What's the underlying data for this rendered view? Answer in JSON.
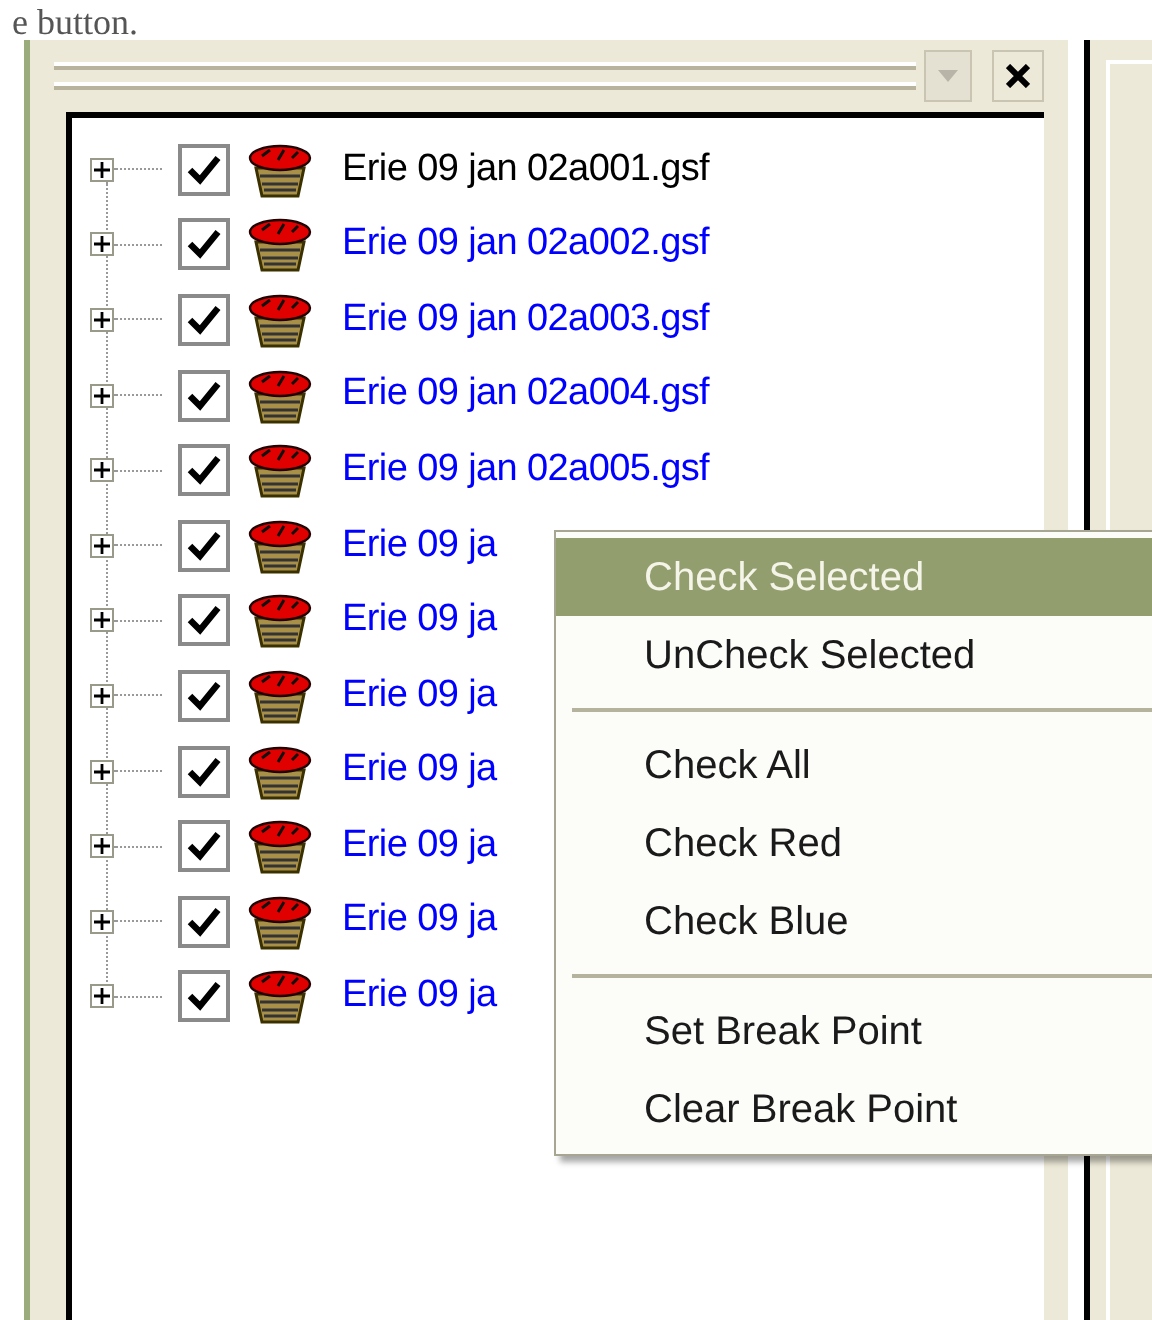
{
  "caption": "e button.",
  "panel": {
    "tree": {
      "items": [
        {
          "label": "Erie 09 jan 02a001.gsf",
          "checked": true,
          "color": "#000000"
        },
        {
          "label": "Erie 09 jan 02a002.gsf",
          "checked": true,
          "color": "#0000ff"
        },
        {
          "label": "Erie 09 jan 02a003.gsf",
          "checked": true,
          "color": "#0000ff"
        },
        {
          "label": "Erie 09 jan 02a004.gsf",
          "checked": true,
          "color": "#0000ff"
        },
        {
          "label": "Erie 09 jan 02a005.gsf",
          "checked": true,
          "color": "#0000ff"
        },
        {
          "label": "Erie 09 ja",
          "checked": true,
          "color": "#0000ff"
        },
        {
          "label": "Erie 09 ja",
          "checked": true,
          "color": "#0000ff"
        },
        {
          "label": "Erie 09 ja",
          "checked": true,
          "color": "#0000ff"
        },
        {
          "label": "Erie 09 ja",
          "checked": true,
          "color": "#0000ff"
        },
        {
          "label": "Erie 09 ja",
          "checked": true,
          "color": "#0000ff"
        },
        {
          "label": "Erie 09 ja",
          "checked": true,
          "color": "#0000ff"
        },
        {
          "label": "Erie 09 ja",
          "checked": true,
          "color": "#0000ff"
        }
      ]
    }
  },
  "context_menu": {
    "items": [
      {
        "kind": "item",
        "label": "Check Selected",
        "selected": true
      },
      {
        "kind": "item",
        "label": "UnCheck Selected",
        "selected": false
      },
      {
        "kind": "separator"
      },
      {
        "kind": "item",
        "label": "Check All",
        "selected": false
      },
      {
        "kind": "item",
        "label": "Check Red",
        "selected": false
      },
      {
        "kind": "item",
        "label": "Check Blue",
        "selected": false
      },
      {
        "kind": "separator"
      },
      {
        "kind": "item",
        "label": "Set Break Point",
        "selected": false
      },
      {
        "kind": "item",
        "label": "Clear Break Point",
        "selected": false
      }
    ]
  }
}
